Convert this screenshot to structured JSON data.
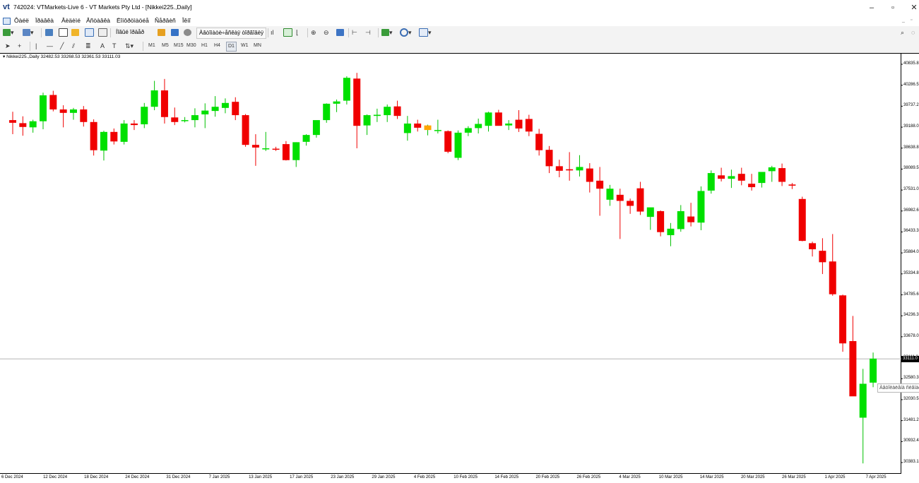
{
  "window": {
    "logo": "vt",
    "title": "742024: VTMarkets-Live 6 - VT Markets Pty Ltd - [Nikkei225.,Daily]",
    "controls": [
      "–",
      "▫",
      "✕"
    ]
  },
  "menu": {
    "items": [
      "Ôàéë",
      "Ïðàâêà",
      "Âèäèìé",
      "Âñòàâêà",
      "Ëîíôðöìàöéå",
      "Ñåðâèñ",
      "Îêíî"
    ],
    "mdi_controls": [
      "_",
      "▫"
    ]
  },
  "toolbar": {
    "new_order_label": "Íîâûé îðäåð",
    "autotrading_label": "Àâòîìàòè÷åñêàÿ òîðãîâëÿ"
  },
  "timeframes": [
    "M1",
    "M5",
    "M15",
    "M30",
    "H1",
    "H4",
    "D1",
    "W1",
    "MN"
  ],
  "active_timeframe": "D1",
  "chart": {
    "info": "Nikkei225.,Daily  32482.53 33268.53 32361.53 33111.03",
    "current_price": "33111.0",
    "tooltip": "Àâòîèàëåíà ñèãíàë",
    "colors": {
      "bull": "#00e000",
      "bear": "#f00000",
      "special": "#ffa500",
      "wick": "#00c000"
    }
  },
  "chart_data": {
    "type": "candlestick",
    "symbol": "Nikkei225.",
    "timeframe": "Daily",
    "y_ticks": [
      "40835.8",
      "40286.5",
      "39737.2",
      "39188.0",
      "38638.8",
      "38089.5",
      "37531.0",
      "36982.6",
      "36433.3",
      "35884.0",
      "35334.8",
      "34785.6",
      "34236.3",
      "33678.0",
      "33111.0",
      "32580.3",
      "32030.5",
      "31481.2",
      "30932.4",
      "30383.1"
    ],
    "x_ticks": [
      "6 Dec 2024",
      "12 Dec 2024",
      "18 Dec 2024",
      "24 Dec 2024",
      "31 Dec 2024",
      "7 Jan 2025",
      "13 Jan 2025",
      "17 Jan 2025",
      "23 Jan 2025",
      "29 Jan 2025",
      "4 Feb 2025",
      "10 Feb 2025",
      "14 Feb 2025",
      "20 Feb 2025",
      "26 Feb 2025",
      "4 Mar 2025",
      "10 Mar 2025",
      "14 Mar 2025",
      "20 Mar 2025",
      "26 Mar 2025",
      "1 Apr 2025",
      "7 Apr 2025"
    ],
    "ylim": [
      30200,
      41000
    ],
    "last_ohlc": {
      "open": 32482.53,
      "high": 33268.53,
      "low": 32361.53,
      "close": 33111.03
    },
    "candles": [
      {
        "o": 39370,
        "h": 39590,
        "l": 39000,
        "c": 39300
      },
      {
        "o": 39290,
        "h": 39470,
        "l": 38960,
        "c": 39190
      },
      {
        "o": 39180,
        "h": 39380,
        "l": 39040,
        "c": 39340
      },
      {
        "o": 39340,
        "h": 40090,
        "l": 39130,
        "c": 40020
      },
      {
        "o": 40030,
        "h": 40140,
        "l": 39600,
        "c": 39650
      },
      {
        "o": 39650,
        "h": 39760,
        "l": 39180,
        "c": 39560
      },
      {
        "o": 39560,
        "h": 39690,
        "l": 39380,
        "c": 39650
      },
      {
        "o": 39650,
        "h": 39740,
        "l": 39200,
        "c": 39320
      },
      {
        "o": 39320,
        "h": 39390,
        "l": 38440,
        "c": 38580
      },
      {
        "o": 38570,
        "h": 39090,
        "l": 38310,
        "c": 39060
      },
      {
        "o": 39060,
        "h": 39150,
        "l": 38730,
        "c": 38810
      },
      {
        "o": 38800,
        "h": 39370,
        "l": 38730,
        "c": 39280
      },
      {
        "o": 39280,
        "h": 39370,
        "l": 39110,
        "c": 39240
      },
      {
        "o": 39260,
        "h": 39820,
        "l": 39160,
        "c": 39720
      },
      {
        "o": 39720,
        "h": 40400,
        "l": 39630,
        "c": 40150
      },
      {
        "o": 40150,
        "h": 40450,
        "l": 39280,
        "c": 39450
      },
      {
        "o": 39440,
        "h": 39700,
        "l": 39240,
        "c": 39320
      },
      {
        "o": 39370,
        "h": 39450,
        "l": 39310,
        "c": 39370
      },
      {
        "o": 39370,
        "h": 39680,
        "l": 39180,
        "c": 39500
      },
      {
        "o": 39520,
        "h": 39810,
        "l": 39160,
        "c": 39620
      },
      {
        "o": 39610,
        "h": 40000,
        "l": 39460,
        "c": 39720
      },
      {
        "o": 39690,
        "h": 39940,
        "l": 39550,
        "c": 39820
      },
      {
        "o": 39850,
        "h": 39970,
        "l": 39370,
        "c": 39500
      },
      {
        "o": 39500,
        "h": 39530,
        "l": 38670,
        "c": 38720
      },
      {
        "o": 38720,
        "h": 39000,
        "l": 38170,
        "c": 38650
      },
      {
        "o": 38620,
        "h": 39060,
        "l": 38560,
        "c": 38630
      },
      {
        "o": 38620,
        "h": 38670,
        "l": 38560,
        "c": 38600
      },
      {
        "o": 38740,
        "h": 38820,
        "l": 38310,
        "c": 38320
      },
      {
        "o": 38320,
        "h": 38790,
        "l": 38140,
        "c": 38790
      },
      {
        "o": 38800,
        "h": 39000,
        "l": 38700,
        "c": 38980
      },
      {
        "o": 38980,
        "h": 39350,
        "l": 38910,
        "c": 39370
      },
      {
        "o": 39370,
        "h": 39810,
        "l": 39300,
        "c": 39800
      },
      {
        "o": 39800,
        "h": 39910,
        "l": 39580,
        "c": 39860
      },
      {
        "o": 39880,
        "h": 40520,
        "l": 39780,
        "c": 40480
      },
      {
        "o": 40460,
        "h": 40610,
        "l": 38630,
        "c": 39220
      },
      {
        "o": 39230,
        "h": 39520,
        "l": 38980,
        "c": 39500
      },
      {
        "o": 39480,
        "h": 39670,
        "l": 39320,
        "c": 39510
      },
      {
        "o": 39500,
        "h": 39780,
        "l": 39320,
        "c": 39720
      },
      {
        "o": 39730,
        "h": 39880,
        "l": 39400,
        "c": 39480
      },
      {
        "o": 39030,
        "h": 39480,
        "l": 38830,
        "c": 39280
      },
      {
        "o": 39280,
        "h": 39380,
        "l": 39070,
        "c": 39170
      },
      {
        "o": 39110,
        "h": 39250,
        "l": 38970,
        "c": 39230
      },
      {
        "o": 39110,
        "h": 39380,
        "l": 39020,
        "c": 39110
      },
      {
        "o": 39080,
        "h": 39100,
        "l": 38500,
        "c": 38540
      },
      {
        "o": 38380,
        "h": 39100,
        "l": 38320,
        "c": 39040
      },
      {
        "o": 39040,
        "h": 39210,
        "l": 38950,
        "c": 39160
      },
      {
        "o": 39160,
        "h": 39410,
        "l": 39020,
        "c": 39270
      },
      {
        "o": 39220,
        "h": 39590,
        "l": 39070,
        "c": 39570
      },
      {
        "o": 39570,
        "h": 39640,
        "l": 39230,
        "c": 39220
      },
      {
        "o": 39230,
        "h": 39370,
        "l": 39110,
        "c": 39280
      },
      {
        "o": 39380,
        "h": 39630,
        "l": 39060,
        "c": 39150
      },
      {
        "o": 39400,
        "h": 39510,
        "l": 38950,
        "c": 39070
      },
      {
        "o": 39010,
        "h": 39140,
        "l": 38440,
        "c": 38580
      },
      {
        "o": 38590,
        "h": 38690,
        "l": 37980,
        "c": 38160
      },
      {
        "o": 38160,
        "h": 38330,
        "l": 37870,
        "c": 38040
      },
      {
        "o": 38080,
        "h": 38530,
        "l": 37780,
        "c": 38050
      },
      {
        "o": 38050,
        "h": 38450,
        "l": 37890,
        "c": 38140
      },
      {
        "o": 38100,
        "h": 38240,
        "l": 37470,
        "c": 37750
      },
      {
        "o": 37780,
        "h": 38140,
        "l": 36860,
        "c": 37570
      },
      {
        "o": 37280,
        "h": 37670,
        "l": 37120,
        "c": 37570
      },
      {
        "o": 37410,
        "h": 37570,
        "l": 36250,
        "c": 37250
      },
      {
        "o": 37250,
        "h": 37310,
        "l": 36910,
        "c": 37120
      },
      {
        "o": 37580,
        "h": 37750,
        "l": 36880,
        "c": 36970
      },
      {
        "o": 36830,
        "h": 37020,
        "l": 36490,
        "c": 37080
      },
      {
        "o": 36980,
        "h": 37000,
        "l": 36320,
        "c": 36430
      },
      {
        "o": 36350,
        "h": 36670,
        "l": 36060,
        "c": 36520
      },
      {
        "o": 36510,
        "h": 37140,
        "l": 36440,
        "c": 36980
      },
      {
        "o": 36840,
        "h": 37200,
        "l": 36580,
        "c": 36690
      },
      {
        "o": 36680,
        "h": 37630,
        "l": 36480,
        "c": 37510
      },
      {
        "o": 37520,
        "h": 38050,
        "l": 37440,
        "c": 37980
      },
      {
        "o": 37920,
        "h": 38120,
        "l": 37760,
        "c": 37830
      },
      {
        "o": 37830,
        "h": 38070,
        "l": 37590,
        "c": 37900
      },
      {
        "o": 37960,
        "h": 38120,
        "l": 37660,
        "c": 37780
      },
      {
        "o": 37700,
        "h": 37960,
        "l": 37520,
        "c": 37610
      },
      {
        "o": 37720,
        "h": 37990,
        "l": 37600,
        "c": 38010
      },
      {
        "o": 38030,
        "h": 38170,
        "l": 37750,
        "c": 38130
      },
      {
        "o": 38110,
        "h": 38230,
        "l": 37640,
        "c": 37750
      },
      {
        "o": 37680,
        "h": 37720,
        "l": 37560,
        "c": 37650
      },
      {
        "o": 37300,
        "h": 37360,
        "l": 36190,
        "c": 36200
      },
      {
        "o": 36140,
        "h": 36180,
        "l": 35790,
        "c": 35980
      },
      {
        "o": 35940,
        "h": 36270,
        "l": 35330,
        "c": 35640
      },
      {
        "o": 35660,
        "h": 36380,
        "l": 34760,
        "c": 34800
      },
      {
        "o": 34770,
        "h": 34790,
        "l": 33290,
        "c": 33510
      },
      {
        "o": 33570,
        "h": 34230,
        "l": 32200,
        "c": 32120
      },
      {
        "o": 31560,
        "h": 32840,
        "l": 30360,
        "c": 32450
      },
      {
        "o": 32480,
        "h": 33270,
        "l": 32360,
        "c": 33110
      }
    ],
    "special_candle_index": 41,
    "crosshair_price": 33111
  }
}
